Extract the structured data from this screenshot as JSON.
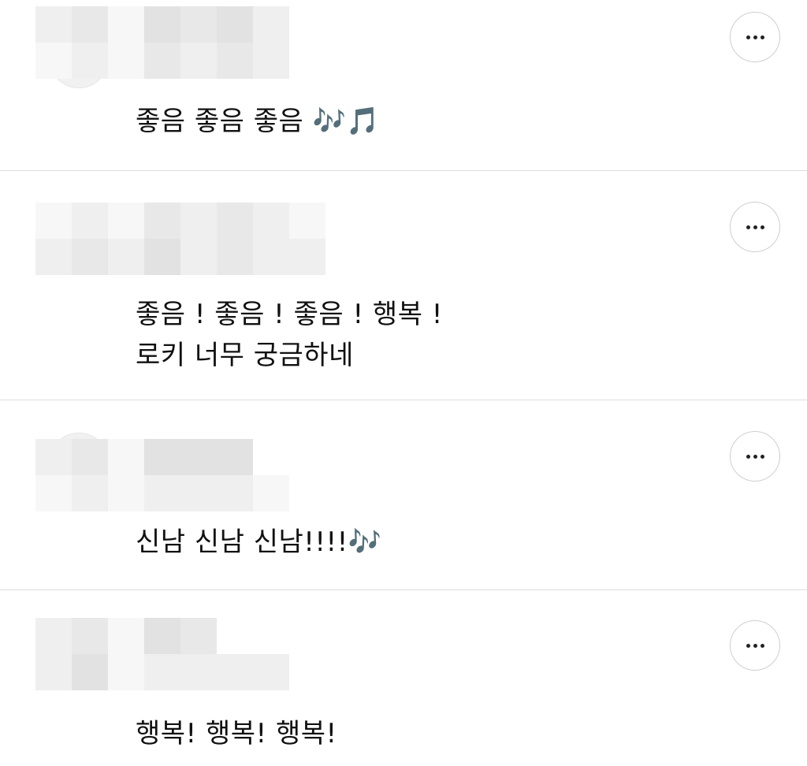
{
  "comments": [
    {
      "text": "좋음 좋음 좋음 🎶🎵",
      "more_icon": "more-horizontal-icon"
    },
    {
      "text": "좋음 ! 좋음 ! 좋음 ! 행복 !\n로키 너무 궁금하네",
      "more_icon": "more-horizontal-icon"
    },
    {
      "text": "신남 신남 신남!!!!🎶",
      "more_icon": "more-horizontal-icon"
    },
    {
      "text": "행복! 행복! 행복!",
      "more_icon": "more-horizontal-icon"
    }
  ],
  "colors": {
    "divider": "#dddddd",
    "button_border": "#cfcfcf",
    "text": "#111111",
    "censor_light": "#f7f7f7",
    "censor_dark": "#dcdcdc"
  }
}
